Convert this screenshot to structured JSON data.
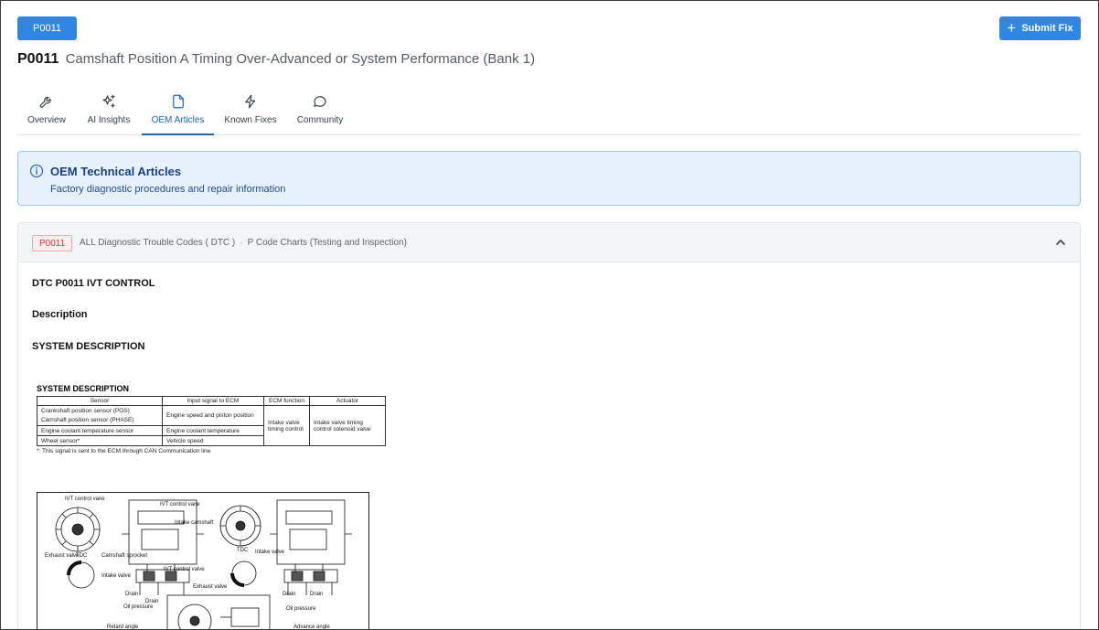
{
  "header": {
    "code_chip": "P0011",
    "submit_label": "Submit Fix",
    "title_code": "P0011",
    "title_desc": "Camshaft Position A Timing Over-Advanced or System Performance (Bank 1)"
  },
  "tabs": [
    {
      "label": "Overview",
      "icon": "wrench-icon",
      "active": false
    },
    {
      "label": "AI Insights",
      "icon": "sparkles-icon",
      "active": false
    },
    {
      "label": "OEM Articles",
      "icon": "document-icon",
      "active": true
    },
    {
      "label": "Known Fixes",
      "icon": "lightning-icon",
      "active": false
    },
    {
      "label": "Community",
      "icon": "chat-bubble-icon",
      "active": false
    }
  ],
  "info_box": {
    "title": "OEM Technical Articles",
    "subtitle": "Factory diagnostic procedures and repair information"
  },
  "article": {
    "badge": "P0011",
    "category": "ALL Diagnostic Trouble Codes ( DTC )",
    "subcategory": "P Code Charts (Testing and Inspection)",
    "heading_1": "DTC P0011 IVT CONTROL",
    "heading_2": "Description",
    "heading_3": "SYSTEM DESCRIPTION",
    "scan": {
      "title": "SYSTEM DESCRIPTION",
      "headers": [
        "Sensor",
        "Input signal to ECM",
        "ECM function",
        "Actuator"
      ],
      "sensors": [
        "Crankshaft position sensor (POS)",
        "Camshaft position sensor (PHASE)",
        "Engine coolant temperature sensor",
        "Wheel sensor*"
      ],
      "signals": [
        "Engine speed and piston position",
        "Engine coolant temperature",
        "Vehicle speed"
      ],
      "ecm_function": "Intake valve timing control",
      "actuator": "Intake valve timing control solenoid valve",
      "footnote": "*: This signal is sent to the ECM through CAN Communication line"
    },
    "diagram_labels": {
      "ivt_vane": "IVT control vane",
      "ivt_vane2": "IVT control vane",
      "intake_camshaft": "Intake camshaft",
      "exhaust_valve": "Exhaust valve",
      "tdc": "TDC",
      "intake_valve": "Intake valve",
      "camshaft_sprocket": "Camshaft sprocket",
      "ivt_control_valve": "IVT control valve",
      "exhaust_valve_2": "Exhaust valve",
      "tdc_2": "TDC",
      "intake_valve_2": "Intake valve",
      "drain": "Drain",
      "drain_2": "Drain",
      "oil_pressure": "Oil pressure",
      "drain_3": "Drain",
      "drain_4": "Drain",
      "oil_pressure_2": "Oil pressure",
      "retard_angle": "Retard angle",
      "advance_angle": "Advance angle"
    }
  }
}
